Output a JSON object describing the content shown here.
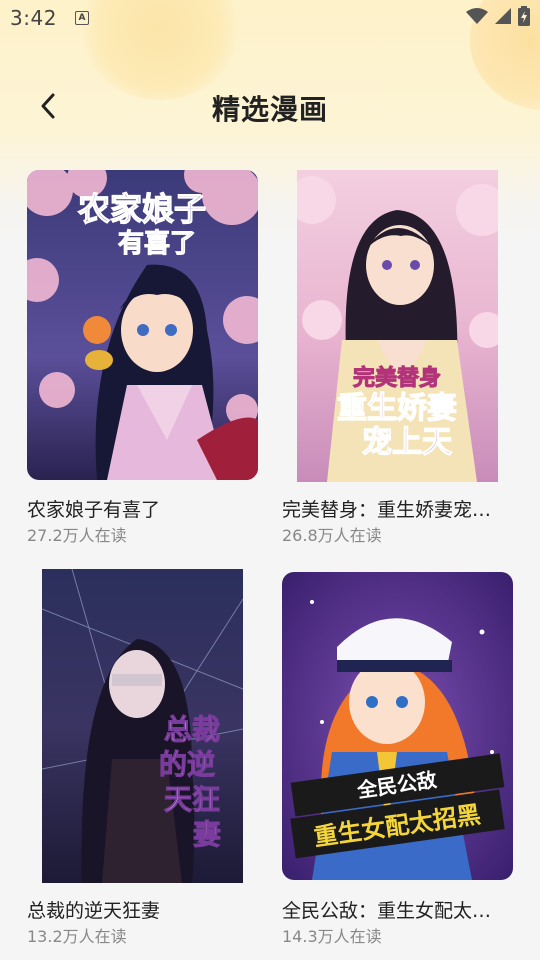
{
  "status_bar": {
    "time": "3:42",
    "notification_icon": "A"
  },
  "header": {
    "title": "精选漫画"
  },
  "comics": [
    {
      "title": "农家娘子有喜了",
      "readers": "27.2万人在读",
      "cover_text": [
        "农家娘子",
        "有喜了"
      ]
    },
    {
      "title": "完美替身：重生娇妻宠…",
      "readers": "26.8万人在读",
      "cover_text": [
        "完美替身",
        "重生娇妻",
        "宠上天"
      ]
    },
    {
      "title": "总裁的逆天狂妻",
      "readers": "13.2万人在读",
      "cover_text": [
        "总裁",
        "的逆",
        "天狂",
        "妻"
      ]
    },
    {
      "title": "全民公敌：重生女配太…",
      "readers": "14.3万人在读",
      "cover_text": [
        "全民公敌",
        "重生女配太招黑"
      ]
    }
  ]
}
